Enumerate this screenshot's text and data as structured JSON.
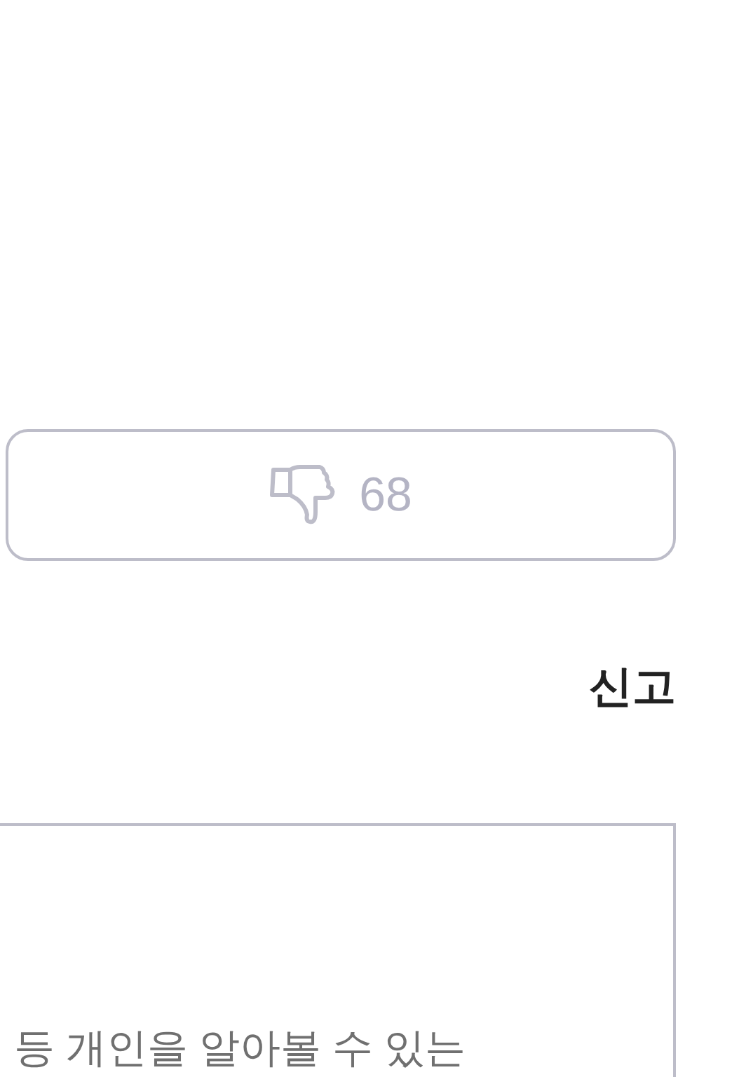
{
  "dislike_button": {
    "count": "68"
  },
  "report_link": "신고",
  "notice": {
    "text": "등 개인을 알아볼 수 있는"
  }
}
